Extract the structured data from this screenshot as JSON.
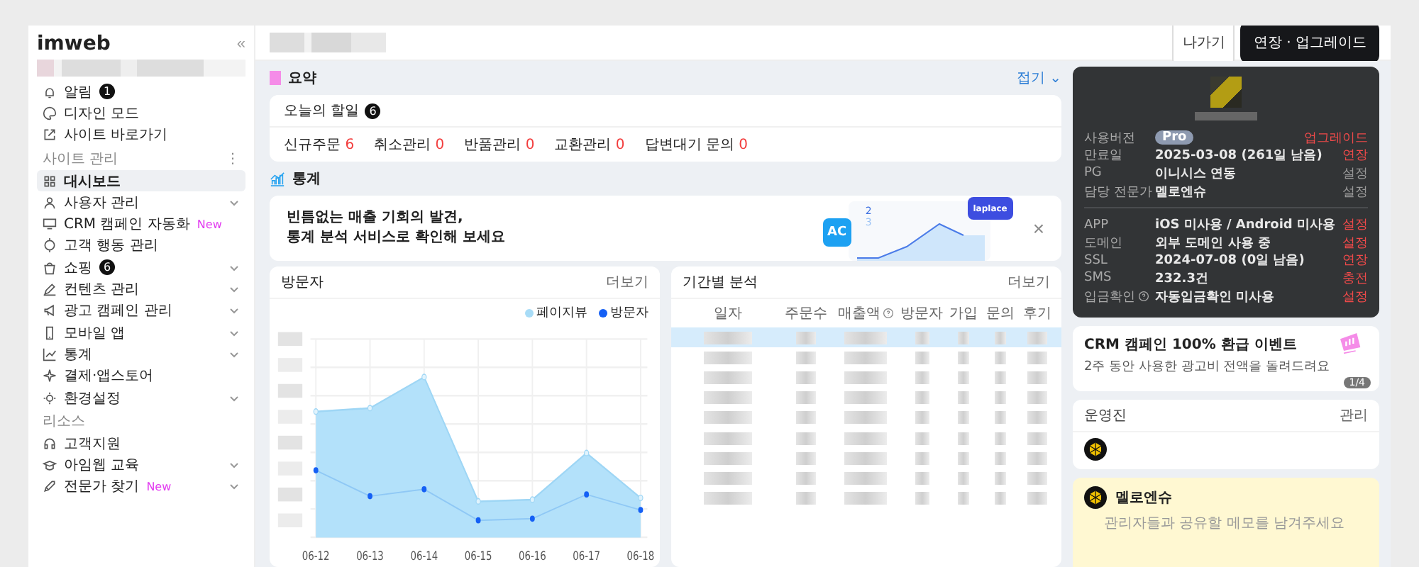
{
  "sidebar": {
    "logo": "imweb",
    "collapse_glyph": "«",
    "quick_items": [
      {
        "label": "알림",
        "badge": "1",
        "selected": false,
        "has_submenu": false
      },
      {
        "label": "디자인 모드",
        "selected": false,
        "has_submenu": false
      },
      {
        "label": "사이트 바로가기",
        "selected": false,
        "has_submenu": false
      }
    ],
    "sections": [
      {
        "title": "사이트 관리",
        "more_glyph": "⋮",
        "items": [
          {
            "label": "대시보드",
            "selected": true,
            "has_submenu": false
          },
          {
            "label": "사용자 관리",
            "selected": false,
            "has_submenu": true
          },
          {
            "label": "CRM 캠페인 자동화",
            "tag": "New",
            "selected": false,
            "has_submenu": false
          },
          {
            "label": "고객 행동 관리",
            "selected": false,
            "has_submenu": false
          },
          {
            "label": "쇼핑",
            "badge": "6",
            "selected": false,
            "has_submenu": true
          },
          {
            "label": "컨텐츠 관리",
            "selected": false,
            "has_submenu": true
          },
          {
            "label": "광고 캠페인 관리",
            "selected": false,
            "has_submenu": true
          },
          {
            "label": "모바일 앱",
            "selected": false,
            "has_submenu": true
          },
          {
            "label": "통계",
            "selected": false,
            "has_submenu": true
          },
          {
            "label": "결제·앱스토어",
            "selected": false,
            "has_submenu": false
          },
          {
            "label": "환경설정",
            "selected": false,
            "has_submenu": true
          }
        ]
      },
      {
        "title": "리소스",
        "items": [
          {
            "label": "고객지원",
            "selected": false,
            "has_submenu": false
          },
          {
            "label": "아임웹 교육",
            "selected": false,
            "has_submenu": true
          },
          {
            "label": "전문가 찾기",
            "tag": "New",
            "selected": false,
            "has_submenu": true
          }
        ]
      }
    ]
  },
  "topbar": {
    "buttons": [
      {
        "label": "나가기",
        "kind": "outline"
      },
      {
        "label": "연장 · 업그레이드",
        "kind": "dark"
      }
    ]
  },
  "summary": {
    "title": "요약",
    "toggle": "접기 ⌄",
    "todo_label": "오늘의 할일",
    "todo_count": "6",
    "counts": [
      {
        "label": "신규주문",
        "value": "6"
      },
      {
        "label": "취소관리",
        "value": "0"
      },
      {
        "label": "반품관리",
        "value": "0"
      },
      {
        "label": "교환관리",
        "value": "0"
      },
      {
        "label": "답변대기 문의",
        "value": "0"
      }
    ]
  },
  "stats": {
    "title": "통계",
    "banner": {
      "lines": [
        "빈틈없는 매출 기회의 발견,",
        "통계 분석 서비스로 확인해 보세요"
      ],
      "close": "×",
      "app_tiles": [
        "AC",
        "laplace"
      ],
      "legend": [
        "2",
        "3"
      ]
    }
  },
  "visitors": {
    "title": "방문자",
    "more": "더보기",
    "legend": [
      {
        "label": "페이지뷰",
        "color": "#a8dcf7"
      },
      {
        "label": "방문자",
        "color": "#1560f5"
      }
    ],
    "x_labels": [
      "06-12",
      "06-13",
      "06-14",
      "06-15",
      "06-16",
      "06-17",
      "06-18"
    ]
  },
  "period": {
    "title": "기간별 분석",
    "more": "더보기",
    "columns": [
      {
        "label": "일자",
        "info": false
      },
      {
        "label": "주문수",
        "info": false
      },
      {
        "label": "매출액",
        "info": true
      },
      {
        "label": "방문자",
        "info": false
      },
      {
        "label": "가입",
        "info": false
      },
      {
        "label": "문의",
        "info": false
      },
      {
        "label": "후기",
        "info": false
      }
    ],
    "blurred_rows": [
      {
        "highlighted": true
      },
      {
        "highlighted": false
      },
      {
        "highlighted": false
      },
      {
        "highlighted": false
      },
      {
        "highlighted": false
      },
      {
        "highlighted": false
      },
      {
        "highlighted": false
      },
      {
        "highlighted": false
      },
      {
        "highlighted": false
      }
    ]
  },
  "plan": {
    "groups": [
      {
        "rows": [
          {
            "label": "사용버전",
            "kind": "badge",
            "value": "Pro",
            "action": "업그레이드",
            "emphasis": true
          },
          {
            "label": "만료일",
            "kind": "text",
            "value": "2025-03-08 (261일 남음)",
            "action": "연장",
            "emphasis": true
          },
          {
            "label": "PG",
            "kind": "text",
            "value": "이니시스 연동",
            "action": "설정",
            "emphasis": false
          },
          {
            "label": "담당 전문가",
            "kind": "text",
            "value": "멜로엔슈",
            "action": "설정",
            "emphasis": false
          }
        ]
      },
      {
        "rows": [
          {
            "label": "APP",
            "kind": "text",
            "value": "iOS 미사용 / Android 미사용",
            "action": "설정",
            "emphasis": true
          },
          {
            "label": "도메인",
            "kind": "text",
            "value": "외부 도메인 사용 중",
            "action": "설정",
            "emphasis": true
          },
          {
            "label": "SSL",
            "kind": "text",
            "value": "2024-07-08 (0일 남음)",
            "action": "연장",
            "emphasis": true
          },
          {
            "label": "SMS",
            "kind": "text",
            "value": "232.3건",
            "action": "충전",
            "emphasis": true
          },
          {
            "label": "입금확인",
            "kind": "info",
            "value": "자동입금확인 미사용",
            "action": "설정",
            "emphasis": true
          }
        ]
      }
    ]
  },
  "promo": {
    "title": "CRM 캠페인 100% 환급 이벤트",
    "text": "2주 동안 사용한 광고비 전액을 돌려드려요",
    "pager": "1/4"
  },
  "staff": {
    "title": "운영진",
    "manage": "관리"
  },
  "memo": {
    "author": "멜로엔슈",
    "placeholder": "관리자들과 공유할 메모를 남겨주세요"
  }
}
